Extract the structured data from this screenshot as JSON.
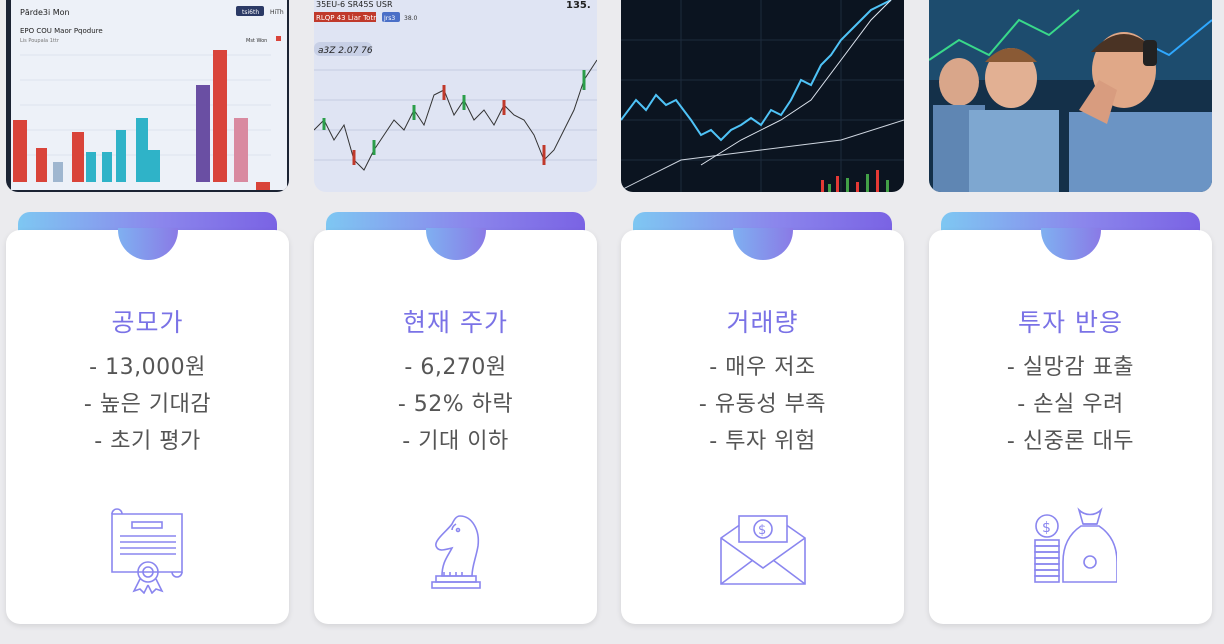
{
  "cards": [
    {
      "title": "공모가",
      "lines": [
        "- 13,000원",
        "- 높은 기대감",
        "- 초기 평가"
      ],
      "icon": "certificate-icon",
      "photo": {
        "label_top": "Pārde3i Mon",
        "label_sub": "EPO COU Maor Pqodure",
        "label_sub2": "Lis Poupala 1ttr",
        "button1": "tsi6th",
        "button2": "HiTh",
        "legend": "Mst Won"
      }
    },
    {
      "title": "현재 주가",
      "lines": [
        "- 6,270원",
        "- 52% 하락",
        "- 기대 이하"
      ],
      "icon": "chess-knight-icon",
      "photo": {
        "label_top": "35EU-6   SR45S USR",
        "ticker": "RLQP 43 Liar Totr",
        "badge": "Jrs3",
        "badge_val": "38.0",
        "price_tag": "a3Z 2.07 76",
        "corner": "135."
      }
    },
    {
      "title": "거래량",
      "lines": [
        "- 매우 저조",
        "- 유동성 부족",
        "- 투자 위험"
      ],
      "icon": "money-envelope-icon",
      "photo": {}
    },
    {
      "title": "투자 반응",
      "lines": [
        "- 실망감 표출",
        "- 손실 우려",
        "- 신중론 대두"
      ],
      "icon": "money-bag-coins-icon",
      "photo": {}
    }
  ],
  "colors": {
    "accent": "#7a72e6",
    "icon": "#8a86ef",
    "body": "#555555"
  }
}
